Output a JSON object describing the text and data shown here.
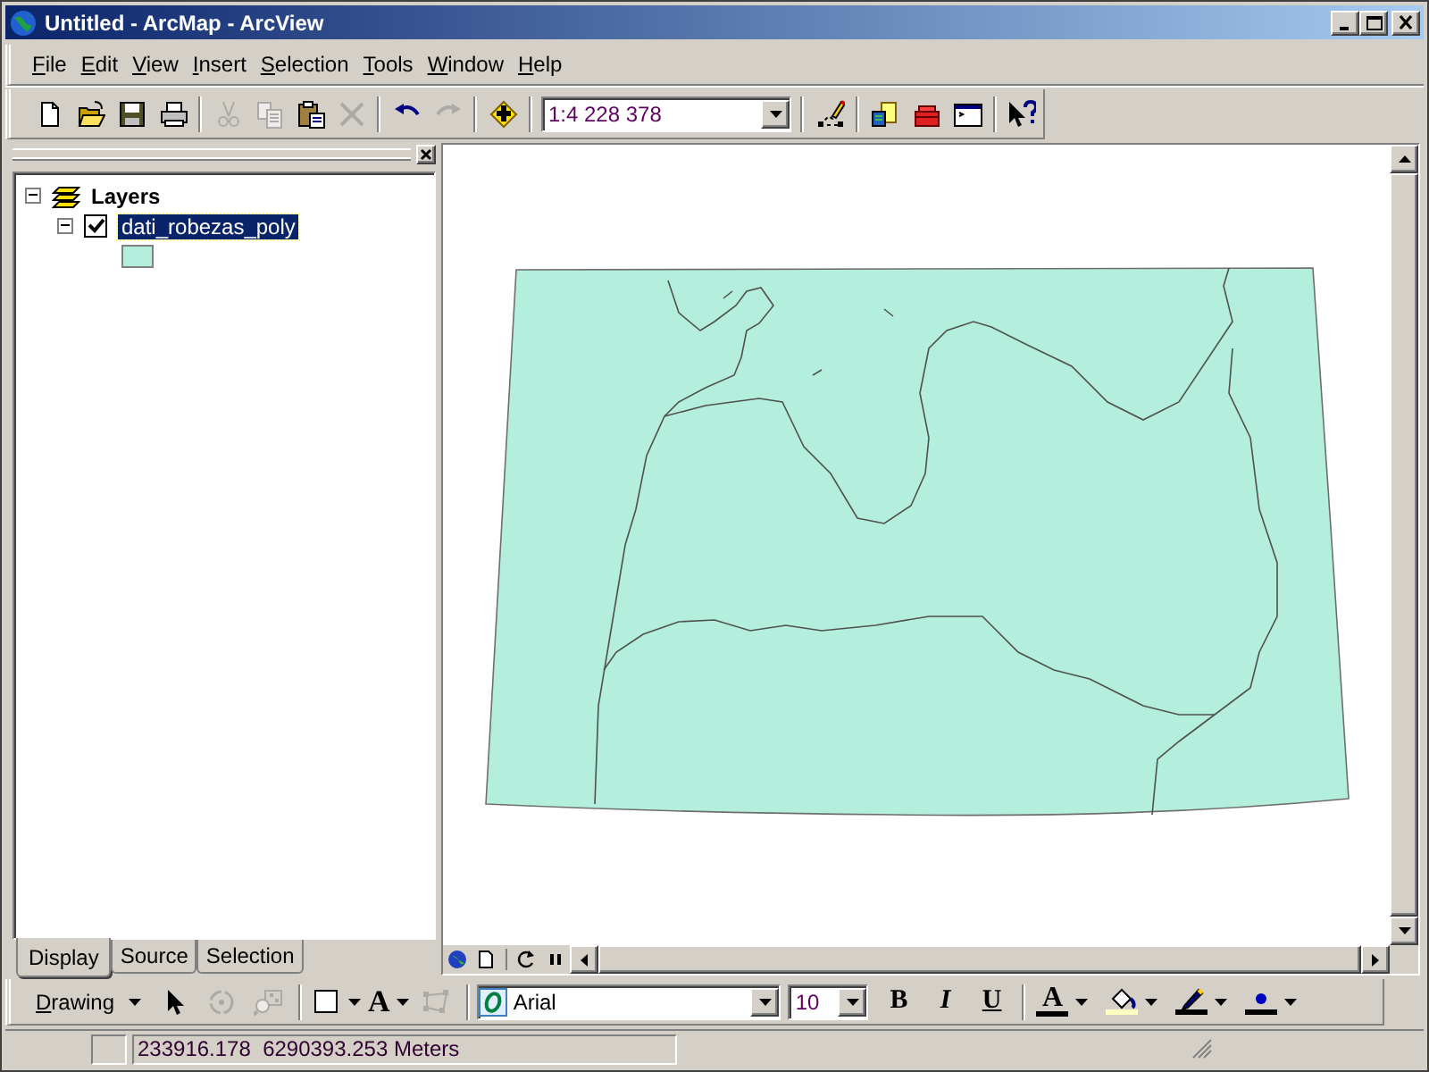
{
  "window": {
    "title": "Untitled - ArcMap - ArcView"
  },
  "menu": [
    {
      "label": "File"
    },
    {
      "label": "Edit"
    },
    {
      "label": "View"
    },
    {
      "label": "Insert"
    },
    {
      "label": "Selection"
    },
    {
      "label": "Tools"
    },
    {
      "label": "Window"
    },
    {
      "label": "Help"
    }
  ],
  "toolbar": {
    "buttons": [
      {
        "kind": "new",
        "disabled": false
      },
      {
        "kind": "open",
        "disabled": false
      },
      {
        "kind": "save",
        "disabled": false
      },
      {
        "kind": "print",
        "disabled": false
      },
      {
        "kind": "sep"
      },
      {
        "kind": "cut",
        "disabled": true
      },
      {
        "kind": "copy",
        "disabled": true
      },
      {
        "kind": "paste",
        "disabled": false
      },
      {
        "kind": "delete",
        "disabled": true
      },
      {
        "kind": "sep"
      },
      {
        "kind": "undo",
        "disabled": false
      },
      {
        "kind": "redo",
        "disabled": true
      },
      {
        "kind": "sep"
      },
      {
        "kind": "add-data",
        "disabled": false
      },
      {
        "kind": "sep"
      },
      {
        "kind": "scale"
      },
      {
        "kind": "sep"
      },
      {
        "kind": "editor",
        "disabled": false
      },
      {
        "kind": "sep"
      },
      {
        "kind": "catalog",
        "disabled": false
      },
      {
        "kind": "toolbox",
        "disabled": false
      },
      {
        "kind": "command",
        "disabled": false
      },
      {
        "kind": "sep"
      },
      {
        "kind": "whats-this",
        "disabled": false
      }
    ],
    "scale": "1:4 228 378"
  },
  "toc": {
    "title": "Layers",
    "expanded": true,
    "layers": [
      {
        "name": "dati_robezas_poly",
        "checked": true,
        "selected": true,
        "expanded": true,
        "color": "#b4eedc"
      }
    ],
    "tabs": [
      {
        "label": "Display",
        "selected": true
      },
      {
        "label": "Source",
        "selected": false
      },
      {
        "label": "Selection",
        "selected": false
      }
    ]
  },
  "drawing_toolbar": {
    "items": [
      {
        "kind": "menu",
        "label": "Drawing",
        "disabled": false
      },
      {
        "kind": "pointer",
        "disabled": false
      },
      {
        "kind": "rotate",
        "disabled": true
      },
      {
        "kind": "zoom-selected",
        "disabled": true
      },
      {
        "kind": "sep"
      },
      {
        "kind": "rectangle",
        "disabled": false,
        "dropdown": true
      },
      {
        "kind": "text",
        "label": "A",
        "disabled": false,
        "dropdown": true
      },
      {
        "kind": "vertices",
        "disabled": true
      },
      {
        "kind": "sep"
      }
    ],
    "font": "Arial",
    "size": "10",
    "format": [
      {
        "kind": "bold",
        "label": "B"
      },
      {
        "kind": "italic",
        "label": "I"
      },
      {
        "kind": "underline",
        "label": "U"
      }
    ],
    "colors": [
      {
        "kind": "font-color",
        "label": "A",
        "color": "#000000"
      },
      {
        "kind": "fill-color",
        "color": "#ffffc0"
      },
      {
        "kind": "line-color",
        "color": "#000000"
      },
      {
        "kind": "marker-color",
        "color": "#000000"
      }
    ]
  },
  "status_bar": {
    "coordinates": "233916.178  6290393.253 Meters"
  }
}
